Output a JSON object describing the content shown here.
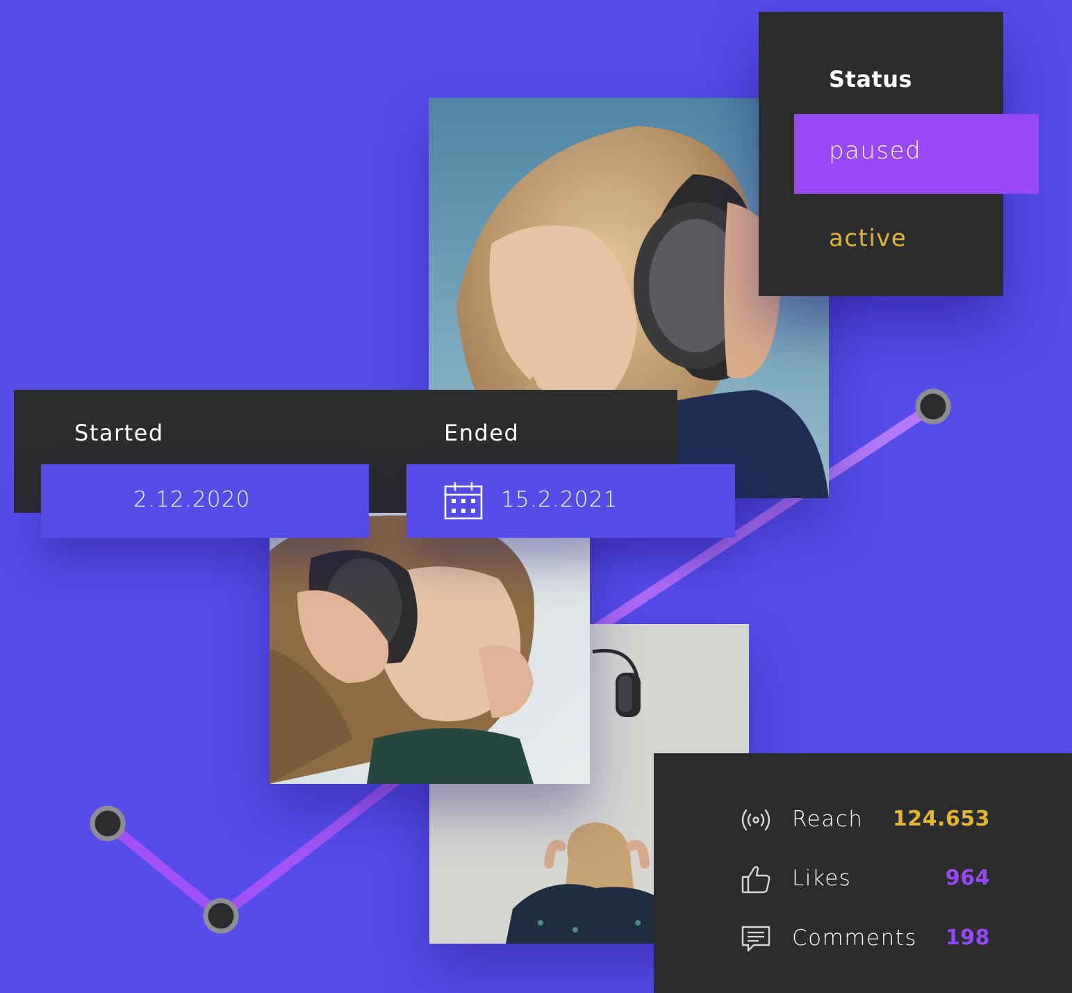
{
  "status": {
    "title": "Status",
    "options": [
      {
        "label": "paused",
        "selected": true
      },
      {
        "label": "active",
        "selected": false
      }
    ]
  },
  "dates": {
    "started": {
      "label": "Started",
      "value": "2.12.2020"
    },
    "ended": {
      "label": "Ended",
      "value": "15.2.2021",
      "icon": "calendar-icon"
    }
  },
  "stats": [
    {
      "icon": "broadcast-icon",
      "label": "Reach",
      "value": "124.653"
    },
    {
      "icon": "thumbs-up-icon",
      "label": "Likes",
      "value": "964"
    },
    {
      "icon": "comment-icon",
      "label": "Comments",
      "value": "198"
    }
  ],
  "colors": {
    "background": "#564ce9",
    "panel": "#2b2c2e",
    "accent_purple": "#9649f5",
    "accent_yellow": "#e5b52f",
    "line_purple": "#a255f5",
    "marker_ring": "#8e8e92"
  }
}
